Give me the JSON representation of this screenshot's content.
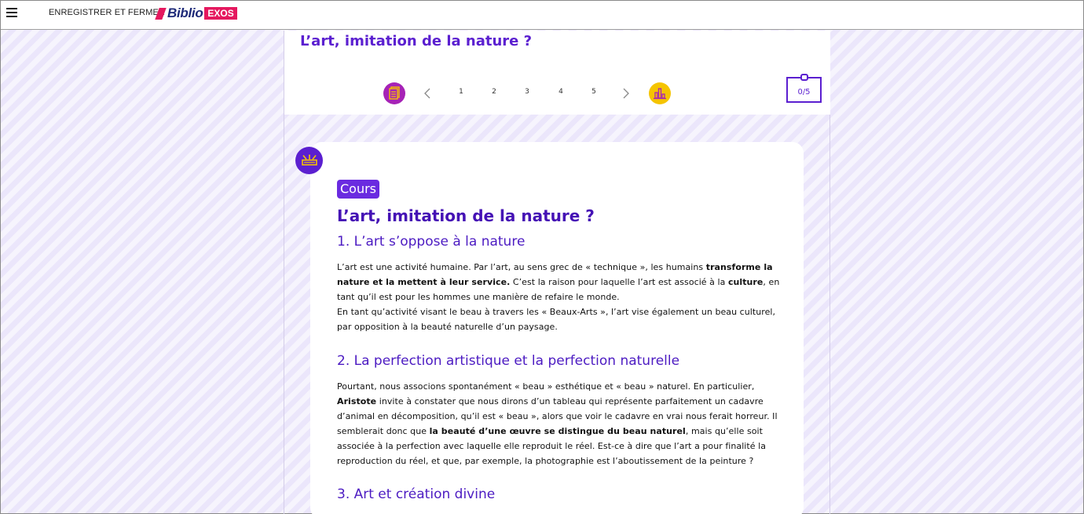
{
  "topbar": {
    "menu_icon": "hamburger-icon",
    "save_close_label": "ENREGISTRER ET FERMER",
    "logo": {
      "biblio": "Biblio",
      "exos": "EXOS"
    }
  },
  "header": {
    "title": "L’art, imitation de la nature ?",
    "pager": {
      "pages": [
        "1",
        "2",
        "3",
        "4",
        "5"
      ],
      "doc_icon": "document-icon",
      "stats_icon": "bar-chart-icon"
    },
    "score": "0/5"
  },
  "card": {
    "tag": "Cours",
    "title": "L’art, imitation de la nature ?",
    "sections": [
      {
        "heading": "1. L’art s’oppose à la nature",
        "p1_a": "L’art est une activité humaine. Par l’art, au sens grec de « technique », les humains ",
        "p1_b": "transforme la nature et la mettent à leur service.",
        "p1_c": " C’est la raison pour laquelle l’art est associé à la ",
        "p1_d": "culture",
        "p1_e": ", en tant qu’il est pour les hommes une manière de refaire le monde.",
        "p2": "En tant qu’activité visant le beau à travers les « Beaux-Arts », l’art vise également un beau culturel, par opposition à la beauté naturelle d’un paysage."
      },
      {
        "heading": "2. La perfection artistique et la perfection naturelle",
        "p1_a": "Pourtant, nous associons spontanément « beau » esthétique et « beau » naturel. En particulier, ",
        "p1_b": "Aristote",
        "p1_c": " invite à constater que nous dirons d’un tableau qui représente parfaitement un cadavre d’animal en décomposition, qu’il est « beau », alors que voir le cadavre en vrai nous ferait horreur. Il semblerait donc que ",
        "p1_d": "la beauté d’une œuvre se distingue du beau naturel",
        "p1_e": ", mais qu’elle soit associée à la perfection avec laquelle elle reproduit le réel. Est-ce à dire que l’art a pour finalité la reproduction du réel, et que, par exemple, la photographie est l’aboutissement de la peinture ?"
      },
      {
        "heading": "3. Art et création divine"
      }
    ]
  }
}
